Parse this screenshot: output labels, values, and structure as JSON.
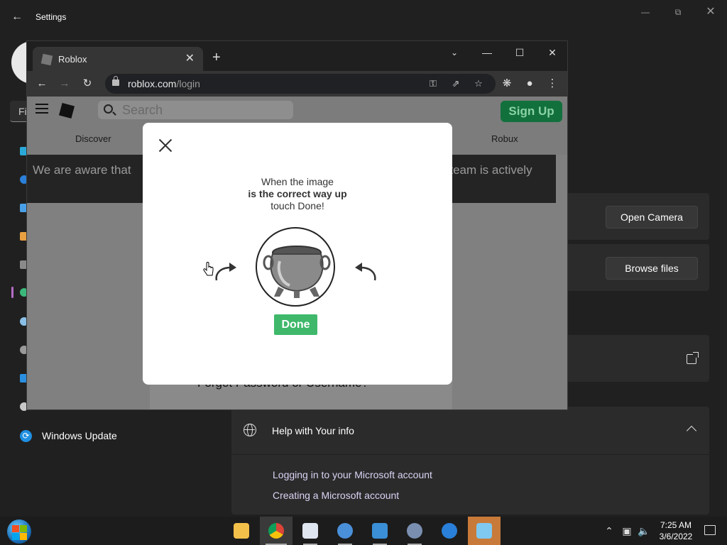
{
  "settings": {
    "title": "Settings",
    "search_stub": "Fi",
    "open_camera": "Open Camera",
    "browse_files": "Browse files",
    "nav_windows_update": "Windows Update",
    "help_title": "Help with Your info",
    "help_links": [
      "Logging in to your Microsoft account",
      "Creating a Microsoft account"
    ]
  },
  "browser": {
    "tab_title": "Roblox",
    "url_host": "roblox.com",
    "url_path": "/login"
  },
  "roblox": {
    "search_placeholder": "Search",
    "signup": "Sign Up",
    "nav_discover": "Discover",
    "nav_robux": "Robux",
    "banner_left": "We are aware that",
    "banner_right": "r team is actively",
    "forgot": "Forgot Password or Username?"
  },
  "captcha": {
    "line1": "When the image",
    "line2": "is the correct way up",
    "line3": "touch Done!",
    "done": "Done",
    "image_icon": "cauldron-image"
  },
  "taskbar": {
    "time": "7:25 AM",
    "date": "3/6/2022"
  },
  "colors": {
    "signup_green": "#12703d",
    "done_green": "#3fb86b",
    "link_purple": "#dcd3f5"
  }
}
